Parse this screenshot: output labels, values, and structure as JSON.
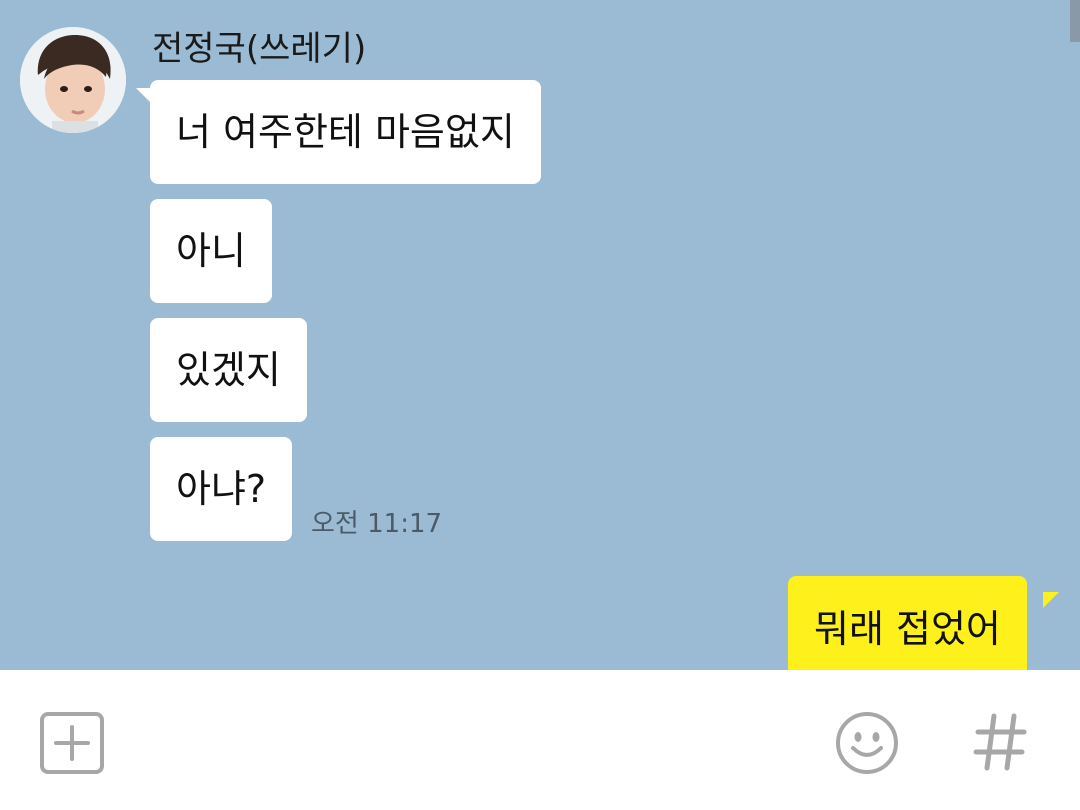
{
  "chat": {
    "sender_name": "전정국(쓰레기)",
    "incoming_messages": [
      {
        "text": "너 여주한테 마음없지"
      },
      {
        "text": "아니"
      },
      {
        "text": "있겠지"
      },
      {
        "text": "아냐?"
      }
    ],
    "incoming_timestamp": "오전 11:17",
    "outgoing_messages": [
      {
        "text": "뭐래 접었어"
      }
    ]
  },
  "colors": {
    "chat_background": "#9bbbd4",
    "incoming_bubble": "#ffffff",
    "outgoing_bubble": "#fef01b",
    "icon_gray": "#a7a7a7"
  },
  "input_bar": {
    "icons": [
      "plus-icon",
      "emoji-icon",
      "hash-icon"
    ]
  }
}
